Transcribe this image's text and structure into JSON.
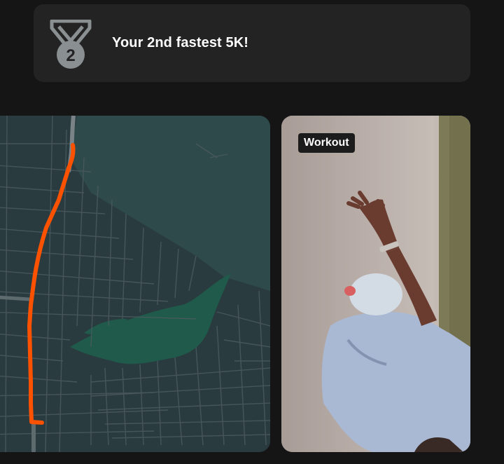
{
  "achievement": {
    "medal_icon": "medal-2-icon",
    "medal_number": "2",
    "text": "Your 2nd fastest 5K!"
  },
  "map": {
    "route_color": "#fc5200",
    "water_color": "#1f5a4a",
    "land_color": "#2b3b40"
  },
  "photo": {
    "tag": "Workout"
  },
  "colors": {
    "background": "#151515",
    "card": "#232323",
    "text": "#ffffff",
    "icon": "#8a8f92"
  }
}
